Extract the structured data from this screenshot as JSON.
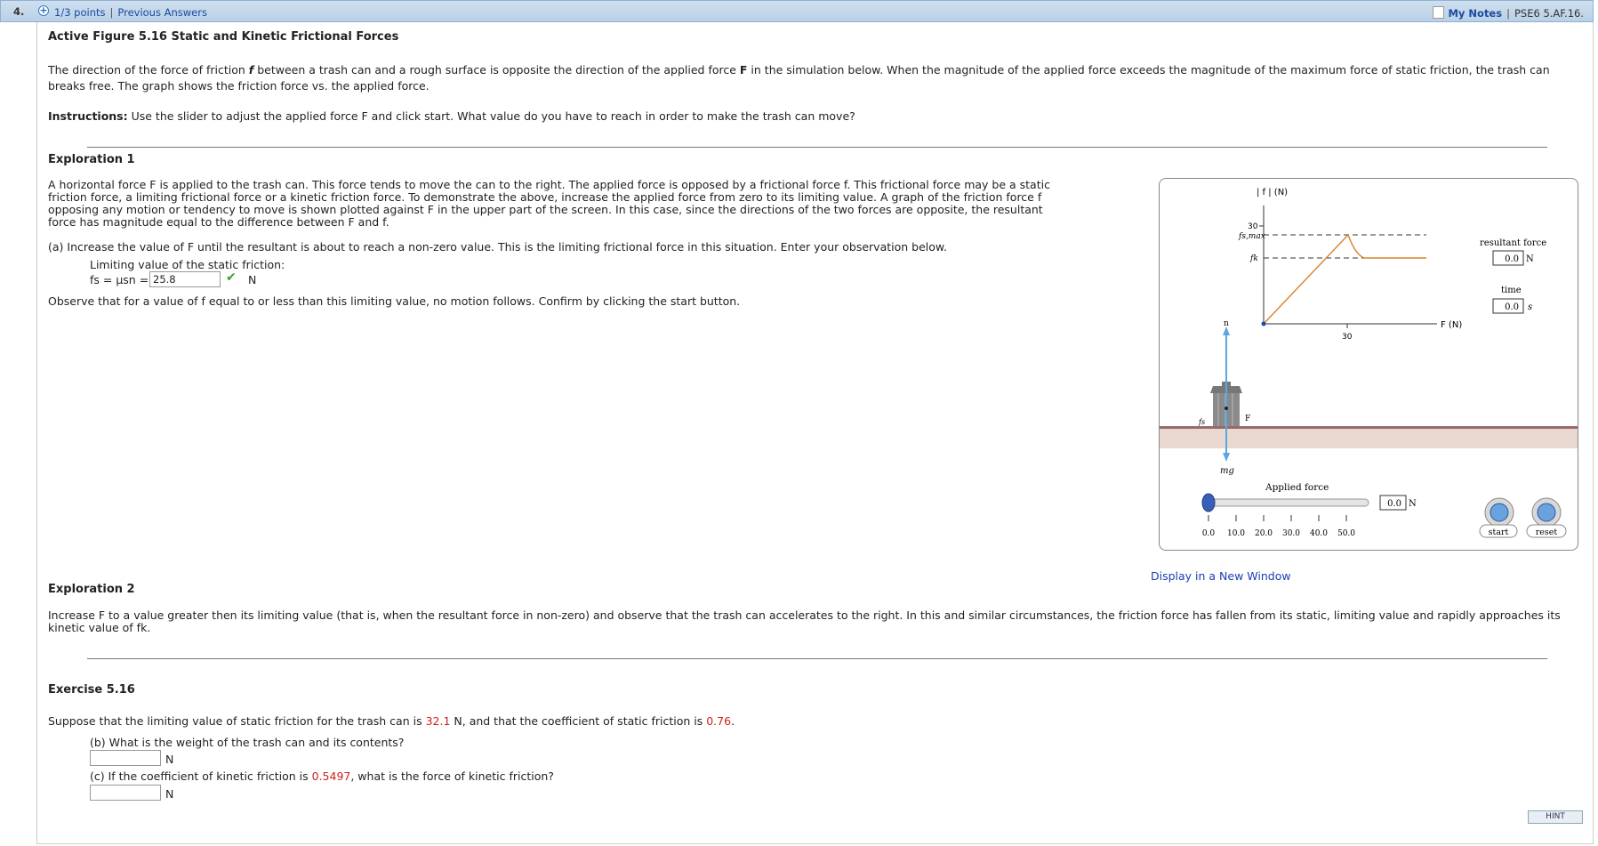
{
  "header": {
    "question_number": "4.",
    "points": "1/3 points",
    "separator": "|",
    "previous_answers": "Previous Answers",
    "my_notes": "My Notes",
    "question_id": "PSE6 5.AF.16."
  },
  "title": "Active Figure 5.16 Static and Kinetic Frictional Forces",
  "intro": {
    "p1a": "The direction of the force of friction ",
    "p1_f": "f",
    "p1b": " between a trash can and a rough surface is opposite the direction of the applied force ",
    "p1_F": "F",
    "p1c": " in the simulation below. When the magnitude of the applied force exceeds the magnitude of the maximum force of static friction, the trash can",
    "p1d": "breaks free. The graph shows the friction force vs. the applied force.",
    "instructions_label": "Instructions:",
    "instructions_text": " Use the slider to adjust the applied force F and click start. What value do you have to reach in order to make the trash can move?"
  },
  "exploration1": {
    "heading": "Exploration 1",
    "line1": "A horizontal force F is applied to the trash can. This force tends to move the can to the right. The applied force is opposed by a frictional force f. This frictional force may be a static",
    "line2": "friction force, a limiting frictional force or a kinetic friction force. To demonstrate the above, increase the applied force from zero to its limiting value. A graph of the friction force f",
    "line3": "opposing any motion or tendency to move is shown plotted against F in the upper part of the screen. In this case, since the directions of the two forces are opposite, the resultant",
    "line4": "force has magnitude equal to the difference between F and f.",
    "part_a": "(a) Increase the value of F until the resultant is about to reach a non-zero value. This is the limiting frictional force in this situation. Enter your observation below.",
    "limiting_label": "Limiting value of the static friction:",
    "formula": "fs = μsn =",
    "answer_value": "25.8",
    "answer_unit": "N",
    "observe": "Observe that for a value of f equal to or less than this limiting value, no motion follows. Confirm by clicking the start button."
  },
  "simulation": {
    "y_axis_label": "| f | (N)",
    "y_tick": "30",
    "fs_max_label": "fs,max",
    "fk_label": "fk",
    "x_axis_label": "F (N)",
    "x_tick": "30",
    "resultant_label": "resultant force",
    "resultant_value": "0.0",
    "resultant_unit": "N",
    "time_label": "time",
    "time_value": "0.0",
    "time_unit": "s",
    "n_label": "n",
    "F_label": "F",
    "fs_label": "fs",
    "mg_label": "mg",
    "applied_force_label": "Applied force",
    "slider_value": "0.0",
    "slider_unit": "N",
    "slider_fraction": 0.0,
    "slider_ticks": [
      "0.0",
      "10.0",
      "20.0",
      "30.0",
      "40.0",
      "50.0"
    ],
    "start_label": "start",
    "reset_label": "reset",
    "colors": {
      "line": "#d9802a",
      "arrow": "#5aa7e6",
      "ground": "#9a6a6a"
    }
  },
  "display_link": "Display in a New Window",
  "exploration2": {
    "heading": "Exploration 2",
    "line1": "Increase F to a value greater then its limiting value (that is, when the resultant force in non-zero) and observe that the trash can accelerates to the right. In this and similar circumstances, the friction force has fallen from its static, limiting value and rapidly approaches its",
    "line2": "kinetic value of fk."
  },
  "exercise": {
    "heading": "Exercise 5.16",
    "s1": "Suppose that the limiting value of static friction for the trash can is ",
    "s_val1": "32.1",
    "s2": " N, and that the coefficient of static friction is ",
    "s_val2": "0.76",
    "s3": ".",
    "part_b": "(b) What is the weight of the trash can and its contents?",
    "part_b_unit": "N",
    "part_c1": "(c) If the coefficient of kinetic friction is ",
    "part_c_val": "0.5497",
    "part_c2": ", what is the force of kinetic friction?",
    "part_c_unit": "N"
  },
  "hint_label": "HINT"
}
